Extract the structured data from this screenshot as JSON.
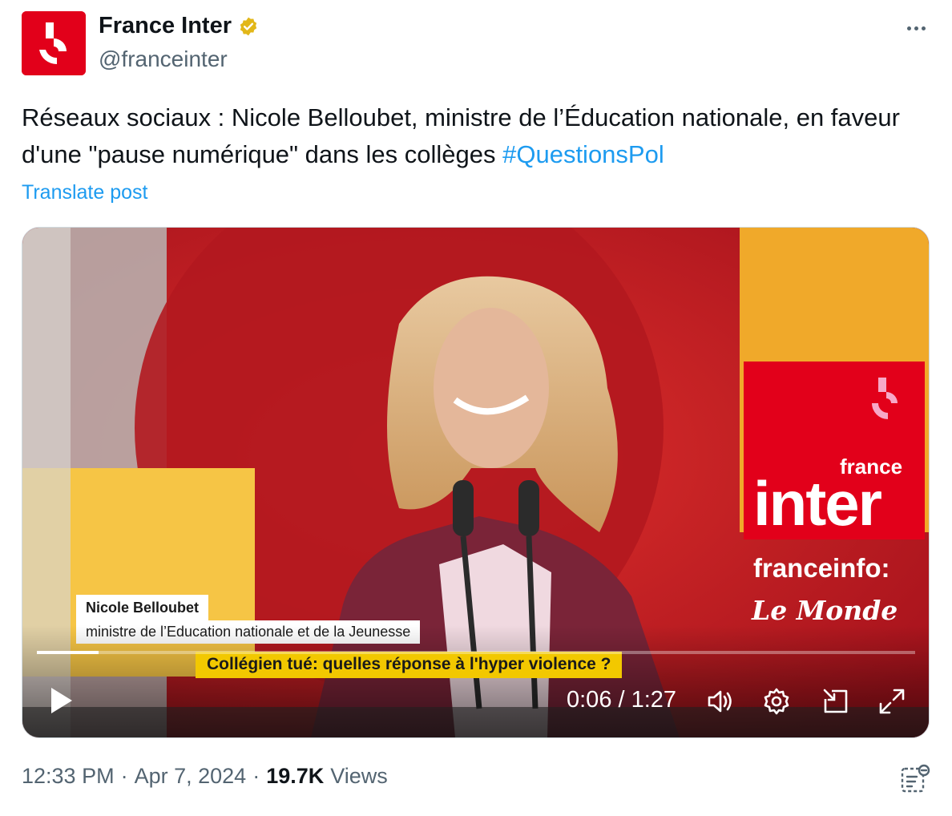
{
  "account": {
    "display_name": "France Inter",
    "handle": "@franceinter",
    "verified_badge_color": "#e2b719",
    "avatar_color": "#e2001a"
  },
  "tweet": {
    "text": "Réseaux sociaux : Nicole Belloubet, ministre de l’Éducation nationale, en faveur d'une \"pause numérique\" dans les collèges ",
    "hashtag": "#QuestionsPol",
    "translate_label": "Translate post"
  },
  "video": {
    "brand_france": "france",
    "brand_inter": "inter",
    "partner_1": "franceinfo:",
    "partner_2": "Le Monde",
    "lower_third_name": "Nicole Belloubet",
    "lower_third_role": "ministre de l’Education nationale et de la Jeunesse",
    "headline": "Collégien tué: quelles réponse à l'hyper violence ?",
    "time_display": "0:06 / 1:27",
    "progress_fraction": 0.07
  },
  "footer": {
    "time": "12:33 PM",
    "separator": "·",
    "date": "Apr 7, 2024",
    "views_count": "19.7K",
    "views_label": "Views"
  },
  "icons": {
    "more": "more-dots-icon",
    "verified": "verified-badge-icon",
    "play": "play-icon",
    "volume": "volume-icon",
    "settings": "settings-gear-icon",
    "pip": "picture-in-picture-icon",
    "fullscreen": "fullscreen-icon",
    "analytics": "analytics-icon"
  }
}
